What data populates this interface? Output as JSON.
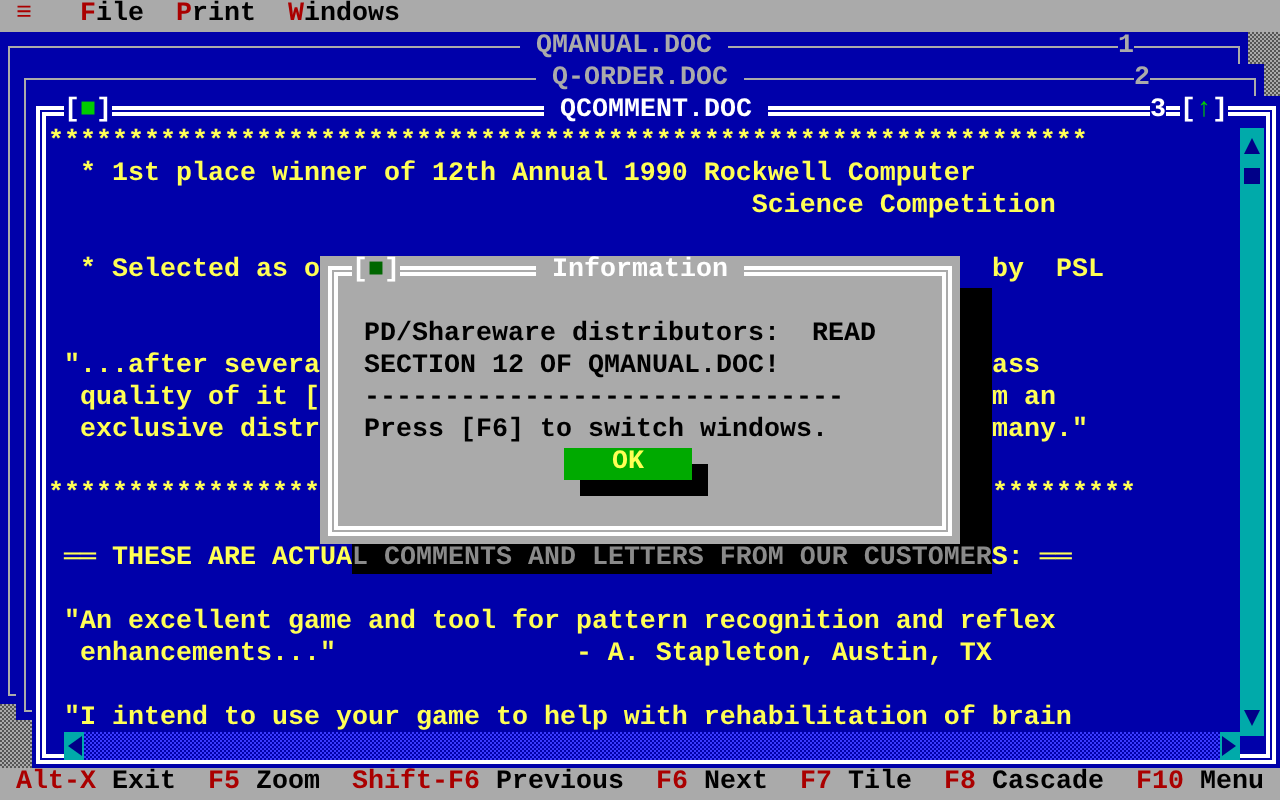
{
  "menu_bar": {
    "system_menu": "≡",
    "items": [
      {
        "label": "File"
      },
      {
        "label": "Print"
      },
      {
        "label": "Windows"
      }
    ]
  },
  "windows": [
    {
      "title": "QMANUAL.DOC",
      "number": "1",
      "active": false
    },
    {
      "title": "Q-ORDER.DOC",
      "number": "2",
      "active": false
    },
    {
      "title": "QCOMMENT.DOC",
      "number": "3",
      "active": true,
      "close_button": "[■]",
      "zoom_button": "[↑]"
    }
  ],
  "document": {
    "lines": [
      {
        "kind": "text",
        "segments": [
          {
            "kind": "plain",
            "text": "*****************************************************************"
          }
        ]
      },
      {
        "kind": "text",
        "segments": [
          {
            "kind": "plain",
            "text": "  * 1st place winner of 12th Annual 1990 Rockwell Computer"
          }
        ]
      },
      {
        "kind": "text",
        "segments": [
          {
            "kind": "plain",
            "text": "                                            Science Competition"
          }
        ]
      },
      {
        "kind": "blank"
      },
      {
        "kind": "text",
        "segments": [
          {
            "kind": "plain",
            "text": "  * Selected as o"
          },
          {
            "kind": "beyond",
            "text": "by  PSL"
          }
        ]
      },
      {
        "kind": "blank"
      },
      {
        "kind": "blank"
      },
      {
        "kind": "text",
        "segments": [
          {
            "kind": "plain",
            "text": " \"...after severa"
          },
          {
            "kind": "beyond",
            "text": "ass"
          }
        ]
      },
      {
        "kind": "text",
        "segments": [
          {
            "kind": "plain",
            "text": "  quality of it ["
          },
          {
            "kind": "beyond",
            "text": "m an"
          }
        ]
      },
      {
        "kind": "text",
        "segments": [
          {
            "kind": "plain",
            "text": "  exclusive distr"
          },
          {
            "kind": "beyond",
            "text": "many.\""
          }
        ]
      },
      {
        "kind": "blank"
      },
      {
        "kind": "text",
        "segments": [
          {
            "kind": "plain",
            "text": "*****************"
          },
          {
            "kind": "beyond",
            "text": "*********"
          }
        ]
      },
      {
        "kind": "blank"
      },
      {
        "kind": "text",
        "segments": [
          {
            "kind": "plain",
            "text": " ══ THESE ARE ACTUA"
          },
          {
            "kind": "shadowed",
            "text": "L COMMENTS AND LETTERS FROM OUR CUSTOMER"
          },
          {
            "kind": "plain",
            "text": "S: ══"
          }
        ]
      },
      {
        "kind": "blank"
      },
      {
        "kind": "text",
        "segments": [
          {
            "kind": "plain",
            "text": " \"An excellent game and tool for pattern recognition and reflex"
          }
        ]
      },
      {
        "kind": "text",
        "segments": [
          {
            "kind": "plain",
            "text": "  enhancements...\"               - A. Stapleton, Austin, TX"
          }
        ]
      },
      {
        "kind": "blank"
      },
      {
        "kind": "text",
        "segments": [
          {
            "kind": "plain",
            "text": " \"I intend to use your game to help with rehabilitation of brain"
          }
        ]
      }
    ]
  },
  "dialog": {
    "title": "Information",
    "close_button": "[■]",
    "lines": [
      "PD/Shareware distributors:  READ",
      "SECTION 12 OF QMANUAL.DOC!",
      "------------------------------",
      "Press [F6] to switch windows."
    ],
    "button": "OK"
  },
  "function_keys": [
    {
      "key": "Alt-X",
      "label": "Exit"
    },
    {
      "key": "F5",
      "label": "Zoom"
    },
    {
      "key": "Shift-F6",
      "label": "Previous"
    },
    {
      "key": "F6",
      "label": "Next"
    },
    {
      "key": "F7",
      "label": "Tile"
    },
    {
      "key": "F8",
      "label": "Cascade"
    },
    {
      "key": "F10",
      "label": "Menu"
    }
  ]
}
